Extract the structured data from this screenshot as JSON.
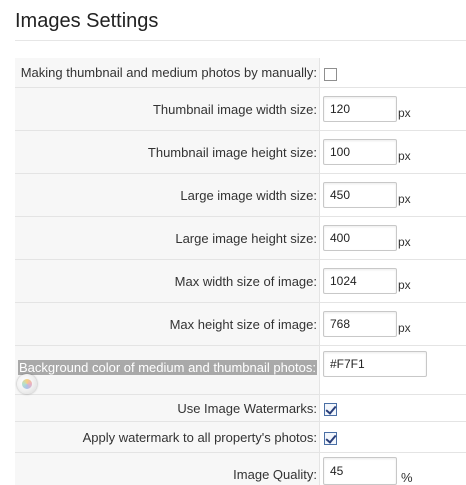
{
  "page_title": "Images Settings",
  "settings": [
    {
      "label": "Making thumbnail and medium photos by manually:",
      "type": "checkbox",
      "checked": false
    },
    {
      "label": "Thumbnail image width size:",
      "type": "number",
      "value": "120",
      "unit": "px"
    },
    {
      "label": "Thumbnail image height size:",
      "type": "number",
      "value": "100",
      "unit": "px"
    },
    {
      "label": "Large image width size:",
      "type": "number",
      "value": "450",
      "unit": "px"
    },
    {
      "label": "Large image height size:",
      "type": "number",
      "value": "400",
      "unit": "px"
    },
    {
      "label": "Max width size of image:",
      "type": "number",
      "value": "1024",
      "unit": "px"
    },
    {
      "label": "Max height size of image:",
      "type": "number",
      "value": "768",
      "unit": "px"
    },
    {
      "label": "Background color of medium and thumbnail photos:",
      "type": "color",
      "value": "#F7F1"
    },
    {
      "label": "Use Image Watermarks:",
      "type": "checkbox",
      "checked": true
    },
    {
      "label": "Apply watermark to all property's photos:",
      "type": "checkbox",
      "checked": true
    },
    {
      "label": "Image Quality:",
      "type": "number",
      "value": "45",
      "unit": "%"
    }
  ],
  "icons": {
    "color_picker": "color-picker-icon"
  },
  "colors": {
    "label_background": "#f7f7f7",
    "highlight": "#a9a9a9",
    "checkbox_check": "#2a3f7a"
  }
}
